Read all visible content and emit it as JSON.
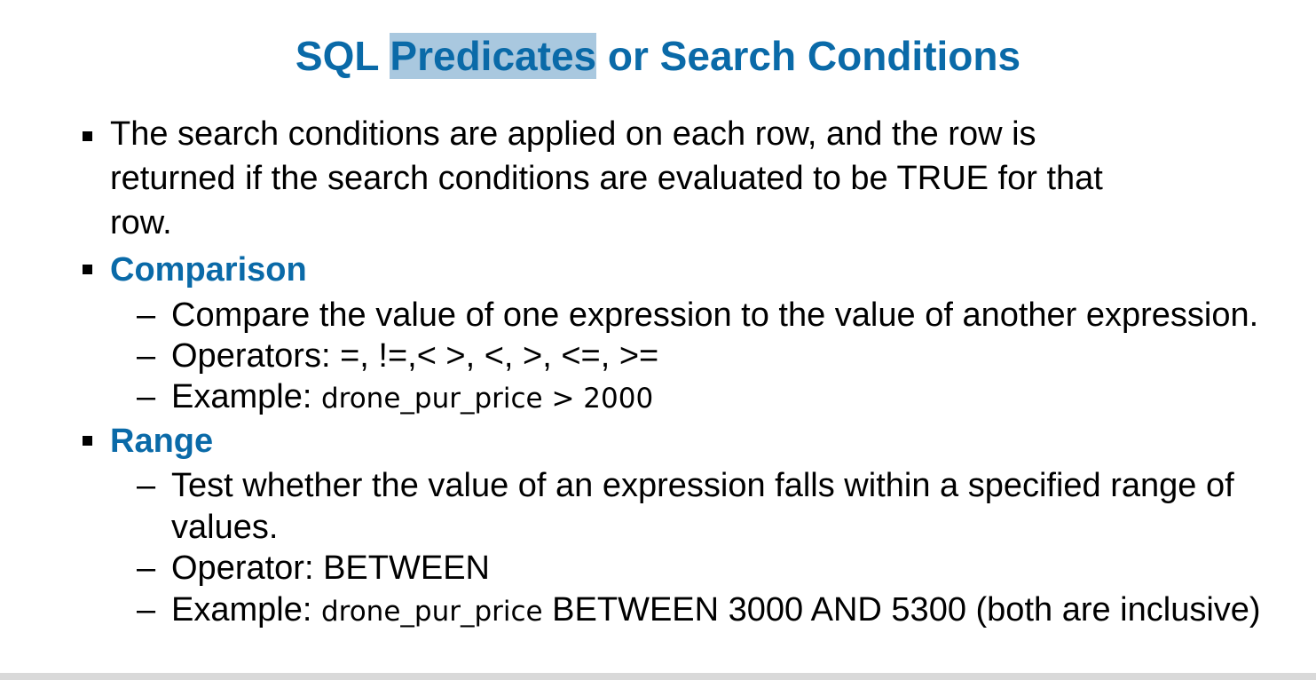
{
  "title": {
    "pre": "SQL ",
    "highlight": "Predicates",
    "post": " or Search Conditions"
  },
  "intro": {
    "line1": "The search conditions are applied on each row, and the row is",
    "line2": "returned if the search conditions are evaluated to be TRUE for that",
    "line3": "row."
  },
  "comparison": {
    "heading": "Comparison",
    "item1": "Compare the value of one expression to the value of another expression.",
    "item2": "Operators: =, !=,< >, <, >, <=, >=",
    "item3_label": "Example: ",
    "item3_code": "drone_pur_price > 2000"
  },
  "range": {
    "heading": "Range",
    "item1_line1": "Test whether the value of an expression falls within a specified range of",
    "item1_line2": "values.",
    "item2": "Operator: BETWEEN",
    "item3_label": "Example: ",
    "item3_code": "drone_pur_price",
    "item3_rest": " BETWEEN 3000 AND 5300 (both are inclusive)"
  },
  "dash_char": "–",
  "colors": {
    "accent": "#0a6aa8",
    "highlight": "#a9c8df",
    "text": "#000000"
  }
}
